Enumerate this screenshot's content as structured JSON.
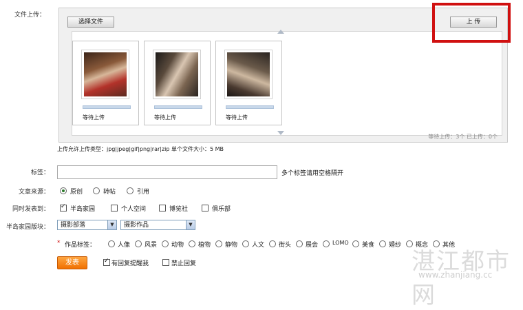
{
  "upload": {
    "label": "文件上传：",
    "select_button": "选择文件",
    "upload_button": "上 传",
    "items": [
      {
        "status": "等待上传"
      },
      {
        "status": "等待上传"
      },
      {
        "status": "等待上传"
      }
    ],
    "summary": "等待上传：3个  已上传：0个",
    "hint": "上传允许上传类型：jpg|jpeg|gif|png|rar|zip 单个文件大小：5 MB"
  },
  "tags": {
    "label": "标签：",
    "value": "",
    "hint": "多个标签请用空格隔开"
  },
  "source": {
    "label": "文章来源：",
    "options": [
      "原创",
      "转帖",
      "引用"
    ],
    "selected": "原创"
  },
  "publish_to": {
    "label": "同时发表到：",
    "options": [
      {
        "label": "半岛家园",
        "checked": true
      },
      {
        "label": "个人空间",
        "checked": false
      },
      {
        "label": "博览社",
        "checked": false
      },
      {
        "label": "俱乐部",
        "checked": false
      }
    ]
  },
  "section": {
    "label": "半岛家园版块：",
    "board": "摄影部落",
    "category": "摄影作品"
  },
  "work_tags": {
    "required_mark": "*",
    "label": "作品标签：",
    "options": [
      "人像",
      "风景",
      "动物",
      "植物",
      "静物",
      "人文",
      "街头",
      "展会",
      "LOMO",
      "美食",
      "婚纱",
      "概念",
      "其他"
    ]
  },
  "footer": {
    "publish_button": "发表",
    "reply_notify": "有回复提醒我",
    "reply_notify_checked": true,
    "disable_reply": "禁止回复",
    "disable_reply_checked": false
  },
  "watermark": {
    "text": "湛江都市网",
    "url": "www.zhanjiang.cc"
  }
}
